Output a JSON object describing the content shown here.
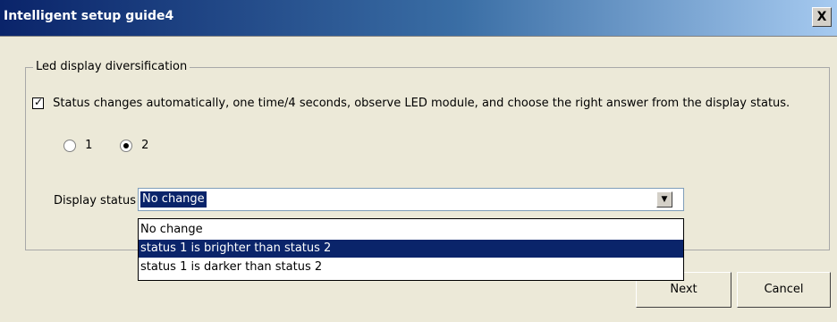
{
  "window": {
    "title": "Intelligent setup guide4",
    "close_label": "X"
  },
  "group": {
    "legend": "Led display diversification",
    "auto_change": {
      "checked": true,
      "label": "Status changes automatically, one time/4 seconds, observe LED module, and choose the right answer from the display status."
    },
    "radios": [
      {
        "label": "1",
        "selected": false
      },
      {
        "label": "2",
        "selected": true
      }
    ],
    "display_status": {
      "label": "Display status",
      "value": "No change",
      "options": [
        {
          "label": "No change",
          "highlighted": false
        },
        {
          "label": "status 1 is brighter than status 2",
          "highlighted": true
        },
        {
          "label": "status 1 is darker than status 2",
          "highlighted": false
        }
      ]
    }
  },
  "buttons": {
    "next": "Next",
    "cancel": "Cancel"
  }
}
